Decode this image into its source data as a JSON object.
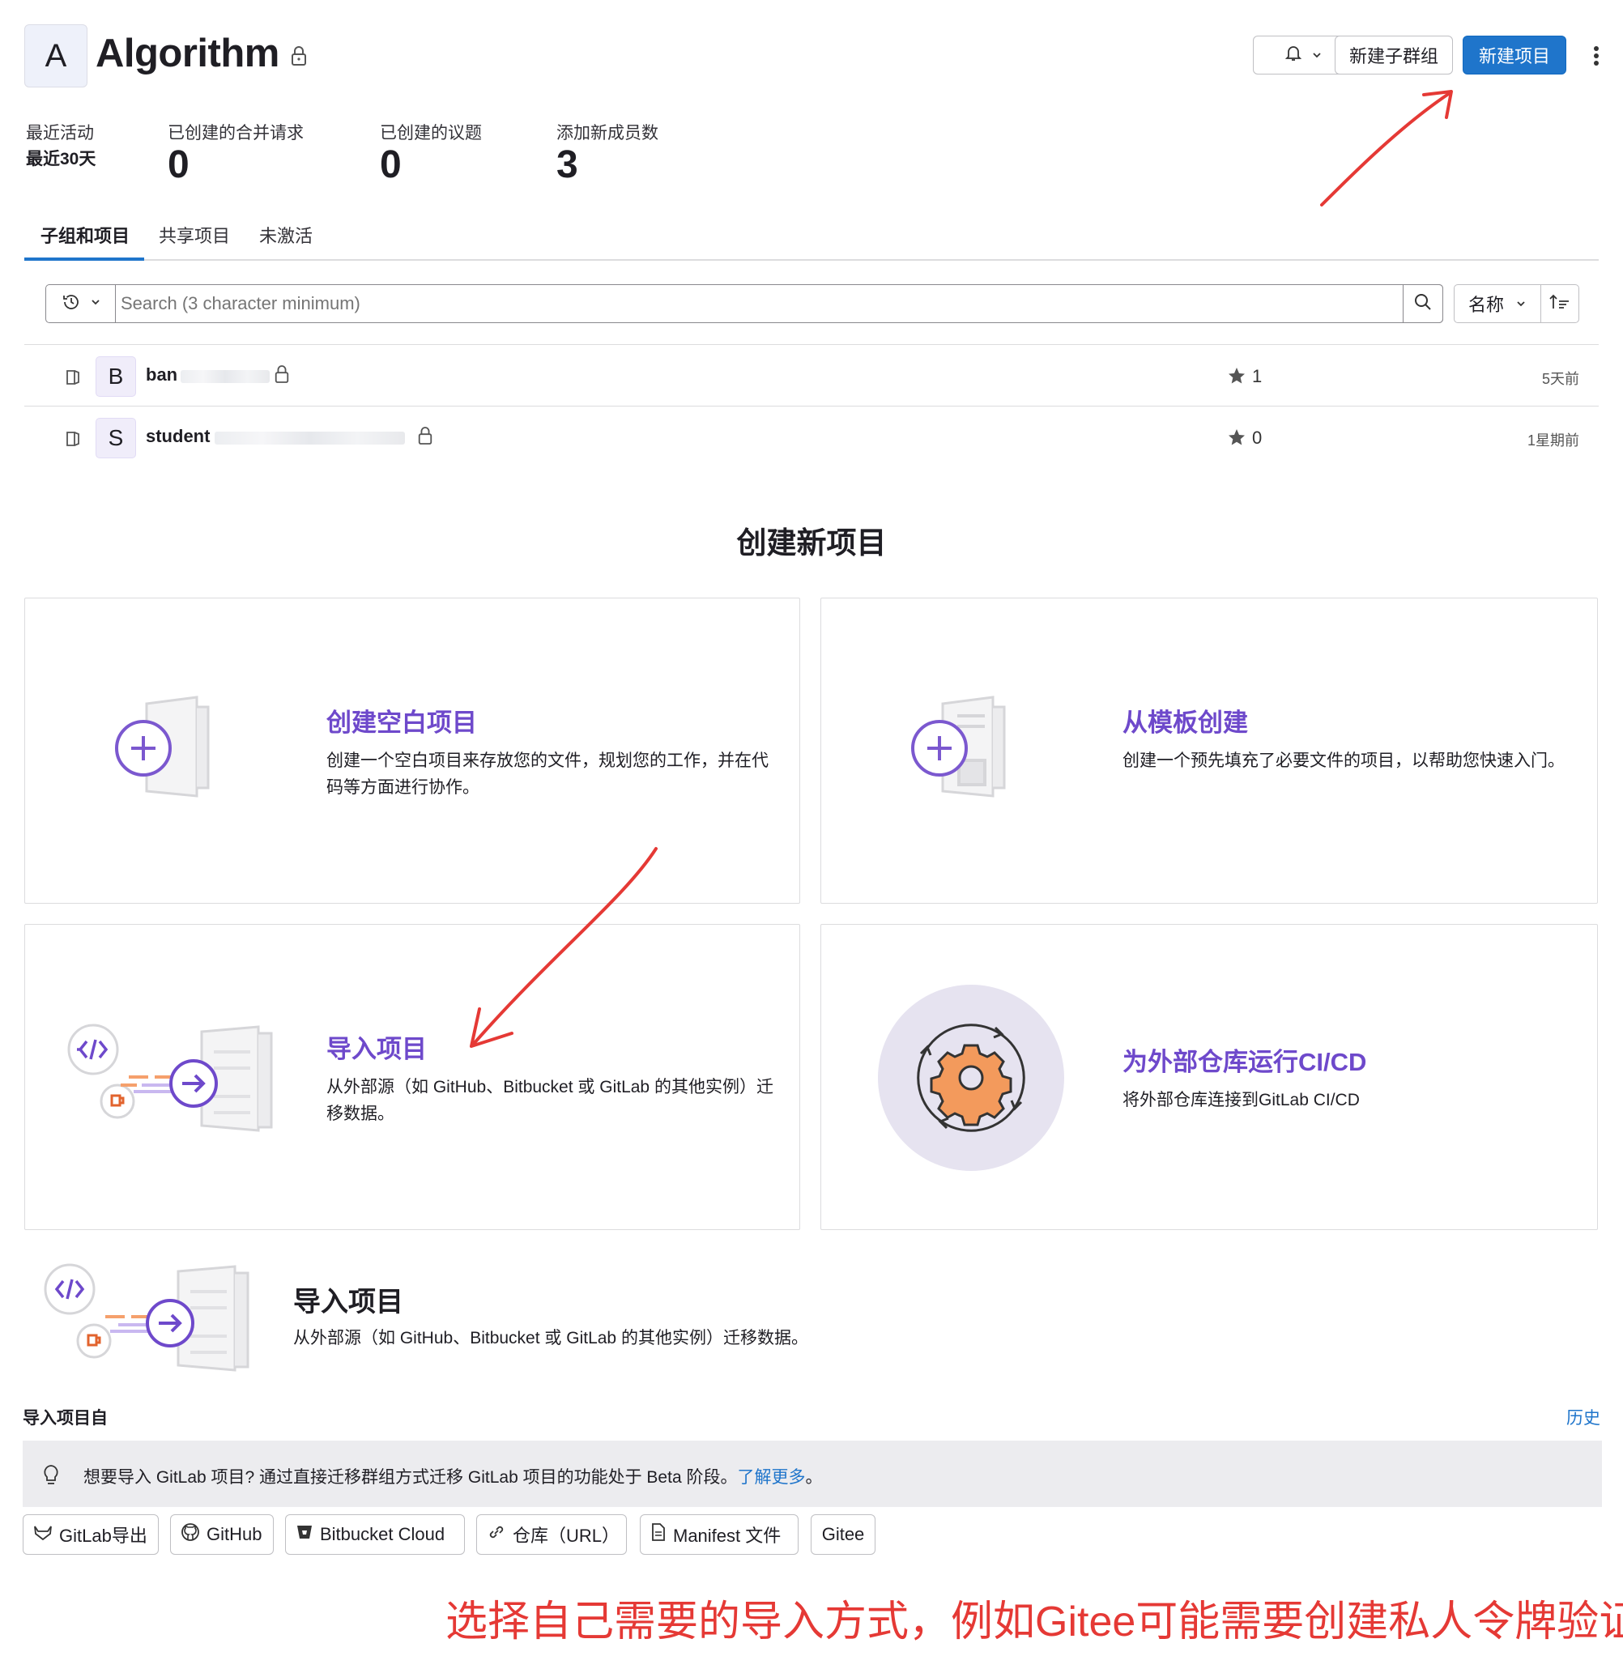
{
  "group": {
    "avatar_letter": "A",
    "name": "Algorithm"
  },
  "header_buttons": {
    "new_subgroup": "新建子群组",
    "new_project": "新建项目"
  },
  "stats": {
    "period_label": "最近活动",
    "period_value": "最近30天",
    "items": [
      {
        "label": "已创建的合并请求",
        "value": "0"
      },
      {
        "label": "已创建的议题",
        "value": "0"
      },
      {
        "label": "添加新成员数",
        "value": "3"
      }
    ]
  },
  "tabs": [
    {
      "label": "子组和项目",
      "active": true
    },
    {
      "label": "共享项目",
      "active": false
    },
    {
      "label": "未激活",
      "active": false
    }
  ],
  "search": {
    "placeholder": "Search (3 character minimum)",
    "sort_label": "名称"
  },
  "projects": [
    {
      "avatar": "B",
      "name": "ban",
      "stars": "1",
      "updated": "5天前"
    },
    {
      "avatar": "S",
      "name": "student",
      "stars": "0",
      "updated": "1星期前"
    }
  ],
  "create_section": {
    "heading": "创建新项目",
    "cards": [
      {
        "title": "创建空白项目",
        "desc": "创建一个空白项目来存放您的文件，规划您的工作，并在代码等方面进行协作。"
      },
      {
        "title": "从模板创建",
        "desc": "创建一个预先填充了必要文件的项目，以帮助您快速入门。"
      },
      {
        "title": "导入项目",
        "desc": "从外部源（如 GitHub、Bitbucket 或 GitLab 的其他实例）迁移数据。"
      },
      {
        "title": "为外部仓库运行CI/CD",
        "desc": "将外部仓库连接到GitLab CI/CD"
      }
    ]
  },
  "import_section": {
    "title": "导入项目",
    "desc": "从外部源（如 GitHub、Bitbucket 或 GitLab 的其他实例）迁移数据。",
    "import_from_label": "导入项目自",
    "history_link": "历史",
    "notice_text": "想要导入 GitLab 项目? 通过直接迁移群组方式迁移 GitLab 项目的功能处于 Beta 阶段。",
    "notice_link": "了解更多",
    "notice_end": "。",
    "sources": [
      "GitLab导出",
      "GitHub",
      "Bitbucket Cloud",
      "仓库（URL）",
      "Manifest 文件",
      "Gitee"
    ]
  },
  "annotation": "选择自己需要的导入方式，例如Gitee可能需要创建私人令牌验证。",
  "colors": {
    "primary": "#1f75cb",
    "purple": "#6e49cb",
    "annotation_red": "#e53935"
  }
}
